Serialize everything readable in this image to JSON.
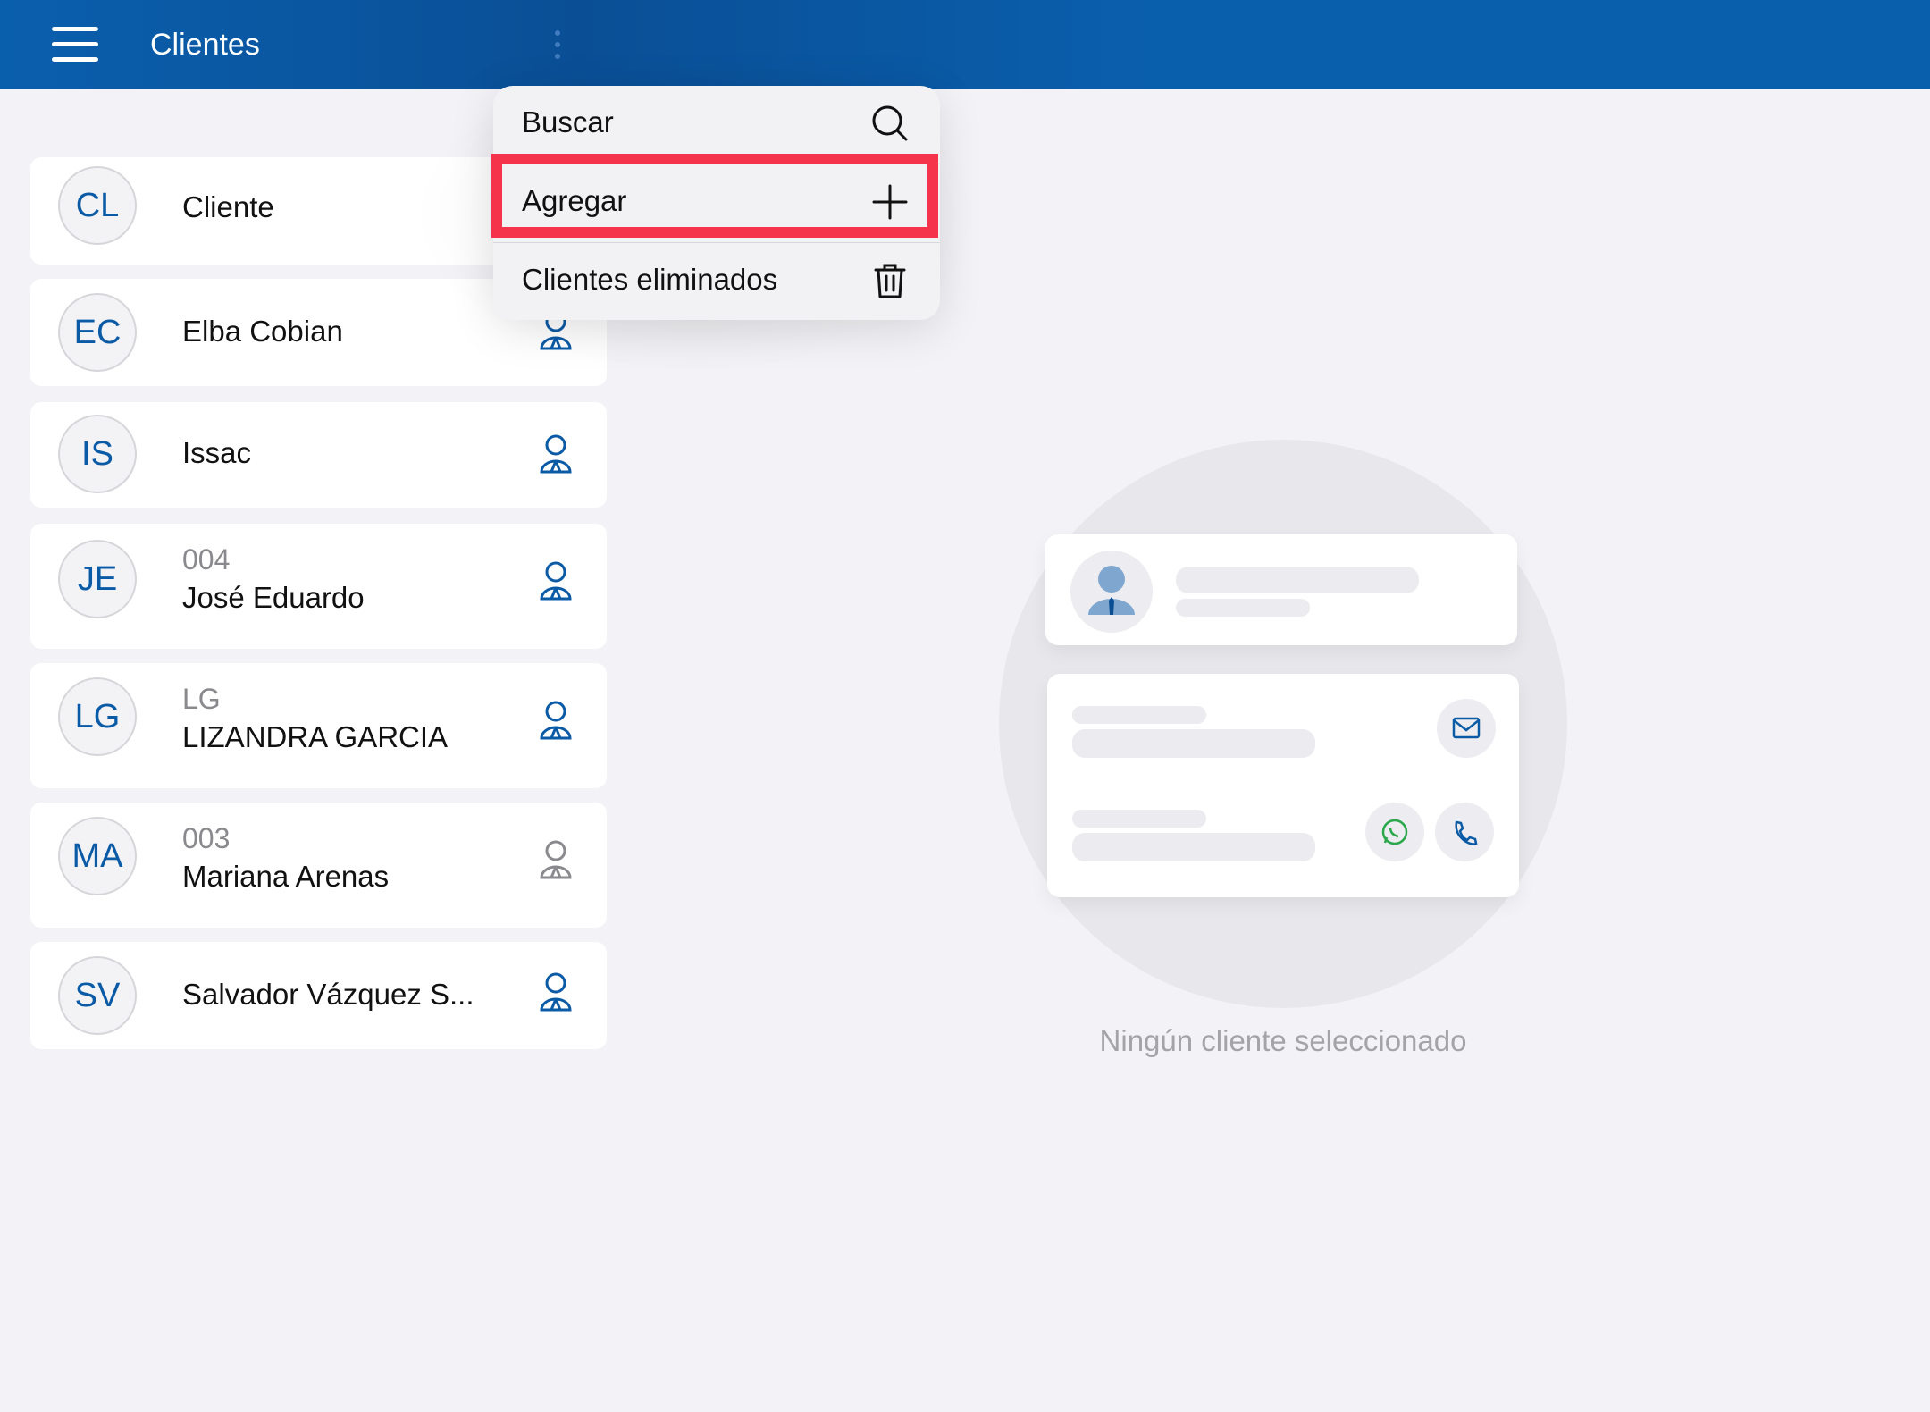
{
  "header": {
    "title": "Clientes",
    "menu_icon": "hamburger-icon",
    "more_icon": "more-vertical-icon"
  },
  "clients": [
    {
      "initials": "CL",
      "code": "",
      "name": "Cliente",
      "icon": "client-icon"
    },
    {
      "initials": "EC",
      "code": "",
      "name": "Elba Cobian",
      "icon": "client-icon"
    },
    {
      "initials": "IS",
      "code": "",
      "name": "Issac",
      "icon": "client-icon"
    },
    {
      "initials": "JE",
      "code": "004",
      "name": "José Eduardo",
      "icon": "client-icon"
    },
    {
      "initials": "LG",
      "code": "LG",
      "name": "LIZANDRA GARCIA",
      "icon": "client-icon"
    },
    {
      "initials": "MA",
      "code": "003",
      "name": "Mariana Arenas",
      "icon": "client-icon-gray"
    },
    {
      "initials": "SV",
      "code": "",
      "name": "Salvador Vázquez S...",
      "icon": "client-icon"
    }
  ],
  "menu": {
    "items": [
      {
        "label": "Buscar",
        "icon": "search-icon"
      },
      {
        "label": "Agregar",
        "icon": "plus-icon"
      },
      {
        "label": "Clientes eliminados",
        "icon": "trash-icon"
      }
    ],
    "highlight_color": "#f5334b"
  },
  "empty_state": {
    "message": "Ningún cliente seleccionado"
  },
  "colors": {
    "primary": "#0a5fad",
    "avatar_text": "#0b5aa6",
    "whatsapp": "#2aa84a"
  }
}
